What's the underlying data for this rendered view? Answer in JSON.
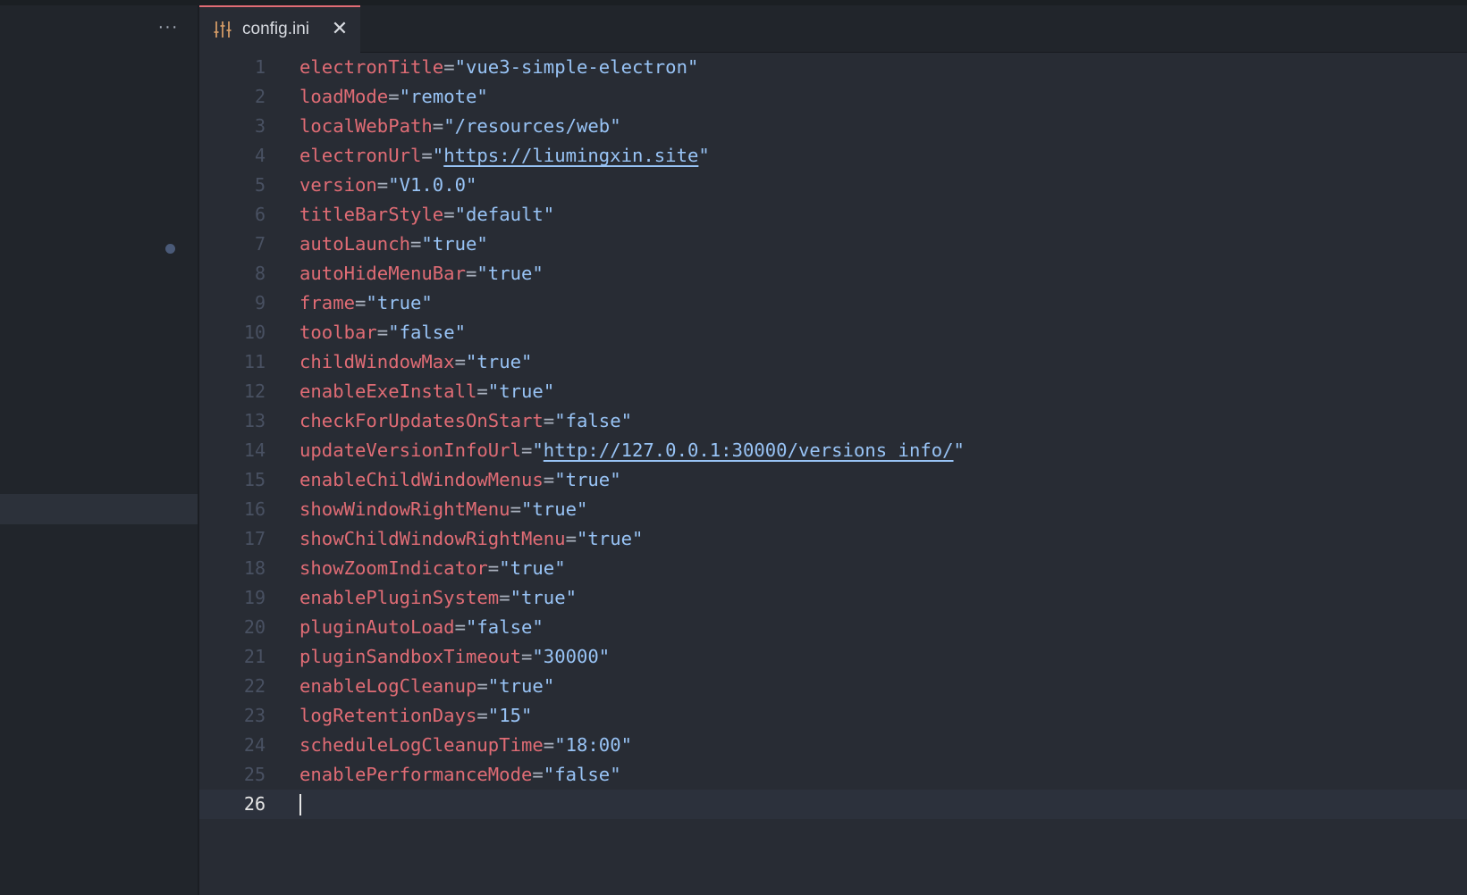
{
  "sidebar": {
    "more_label": "···"
  },
  "tab": {
    "title": "config.ini",
    "close_label": "✕"
  },
  "editor": {
    "current_line": 26,
    "lines": [
      {
        "n": "1",
        "key": "electronTitle",
        "value": "vue3-simple-electron",
        "link": false
      },
      {
        "n": "2",
        "key": "loadMode",
        "value": "remote",
        "link": false
      },
      {
        "n": "3",
        "key": "localWebPath",
        "value": "/resources/web",
        "link": false
      },
      {
        "n": "4",
        "key": "electronUrl",
        "value": "https://liumingxin.site",
        "link": true
      },
      {
        "n": "5",
        "key": "version",
        "value": "V1.0.0",
        "link": false
      },
      {
        "n": "6",
        "key": "titleBarStyle",
        "value": "default",
        "link": false
      },
      {
        "n": "7",
        "key": "autoLaunch",
        "value": "true",
        "link": false
      },
      {
        "n": "8",
        "key": "autoHideMenuBar",
        "value": "true",
        "link": false
      },
      {
        "n": "9",
        "key": "frame",
        "value": "true",
        "link": false
      },
      {
        "n": "10",
        "key": "toolbar",
        "value": "false",
        "link": false
      },
      {
        "n": "11",
        "key": "childWindowMax",
        "value": "true",
        "link": false
      },
      {
        "n": "12",
        "key": "enableExeInstall",
        "value": "true",
        "link": false
      },
      {
        "n": "13",
        "key": "checkForUpdatesOnStart",
        "value": "false",
        "link": false
      },
      {
        "n": "14",
        "key": "updateVersionInfoUrl",
        "value": "http://127.0.0.1:30000/versions_info/",
        "link": true
      },
      {
        "n": "15",
        "key": "enableChildWindowMenus",
        "value": "true",
        "link": false
      },
      {
        "n": "16",
        "key": "showWindowRightMenu",
        "value": "true",
        "link": false
      },
      {
        "n": "17",
        "key": "showChildWindowRightMenu",
        "value": "true",
        "link": false
      },
      {
        "n": "18",
        "key": "showZoomIndicator",
        "value": "true",
        "link": false
      },
      {
        "n": "19",
        "key": "enablePluginSystem",
        "value": "true",
        "link": false
      },
      {
        "n": "20",
        "key": "pluginAutoLoad",
        "value": "false",
        "link": false
      },
      {
        "n": "21",
        "key": "pluginSandboxTimeout",
        "value": "30000",
        "link": false
      },
      {
        "n": "22",
        "key": "enableLogCleanup",
        "value": "true",
        "link": false
      },
      {
        "n": "23",
        "key": "logRetentionDays",
        "value": "15",
        "link": false
      },
      {
        "n": "24",
        "key": "scheduleLogCleanupTime",
        "value": "18:00",
        "link": false
      },
      {
        "n": "25",
        "key": "enablePerformanceMode",
        "value": "false",
        "link": false
      },
      {
        "n": "26",
        "key": "",
        "value": "",
        "link": false
      }
    ]
  },
  "icons": {
    "tab_icon": "settings-sliders-icon",
    "close": "close-icon",
    "more": "more-horizontal-icon"
  },
  "colors": {
    "key": "#e06c75",
    "string": "#98c3f5",
    "tab_accent": "#e06c75",
    "background": "#282c34"
  }
}
